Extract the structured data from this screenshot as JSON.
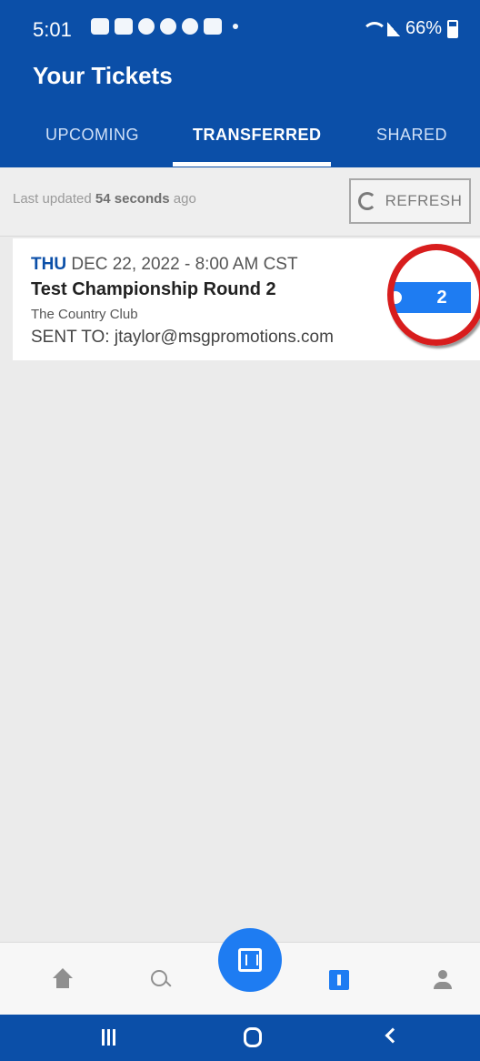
{
  "status_bar": {
    "time": "5:01",
    "battery": "66%"
  },
  "header": {
    "title": "Your Tickets"
  },
  "tabs": [
    {
      "label": "UPCOMING",
      "active": false
    },
    {
      "label": "TRANSFERRED",
      "active": true
    },
    {
      "label": "SHARED",
      "active": false
    }
  ],
  "update_bar": {
    "prefix": "Last updated ",
    "elapsed": "54 seconds",
    "suffix": " ago",
    "refresh_label": "REFRESH"
  },
  "event": {
    "day": "THU",
    "datetime": " DEC 22, 2022 - 8:00 AM CST",
    "name": "Test Championship Round 2",
    "venue": "The Country Club",
    "sent_to": "SENT TO: jtaylor@msgpromotions.com",
    "ticket_count": "2"
  },
  "bottom_nav": {
    "items": [
      "home-icon",
      "search-icon",
      "scan-barcode-icon",
      "tickets-icon",
      "account-icon"
    ],
    "active": "tickets-icon"
  },
  "colors": {
    "brand_blue": "#0b4fa8",
    "accent_blue": "#1e7cf2",
    "highlight_red": "#d81d1d"
  }
}
